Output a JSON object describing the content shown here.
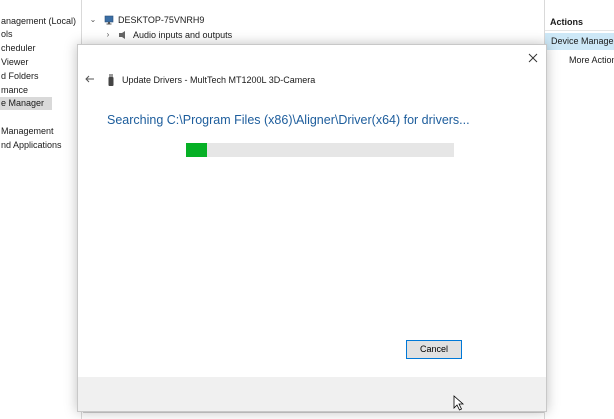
{
  "left_tree": {
    "items": [
      {
        "label": "anagement (Local)"
      },
      {
        "label": "ols"
      },
      {
        "label": "cheduler"
      },
      {
        "label": "Viewer"
      },
      {
        "label": "d Folders"
      },
      {
        "label": "mance"
      },
      {
        "label": "e Manager"
      },
      {
        "label": "Management"
      },
      {
        "label": "nd Applications"
      }
    ]
  },
  "device_tree": {
    "computer_name": "DESKTOP-75VNRH9",
    "first_category": "Audio inputs and outputs"
  },
  "actions": {
    "header": "Actions",
    "device_manager": "Device Manager",
    "more_actions": "More Actions"
  },
  "dialog": {
    "title": "Update Drivers - MultTech MT1200L 3D-Camera",
    "status": "Searching C:\\Program Files (x86)\\Aligner\\Driver(x64) for drivers...",
    "progress_fraction": 0.08,
    "cancel_label": "Cancel"
  },
  "colors": {
    "progress": "#06b025",
    "status_text": "#1d5d9c",
    "selection": "#cde8f7",
    "button_border": "#0078d7"
  },
  "icons": {
    "close": "close-icon",
    "back": "back-arrow-icon",
    "device": "usb-device-icon",
    "computer": "computer-icon",
    "audio": "speaker-icon",
    "expand": "chevron-down-icon",
    "collapse": "chevron-right-icon",
    "cursor": "mouse-pointer-icon"
  }
}
